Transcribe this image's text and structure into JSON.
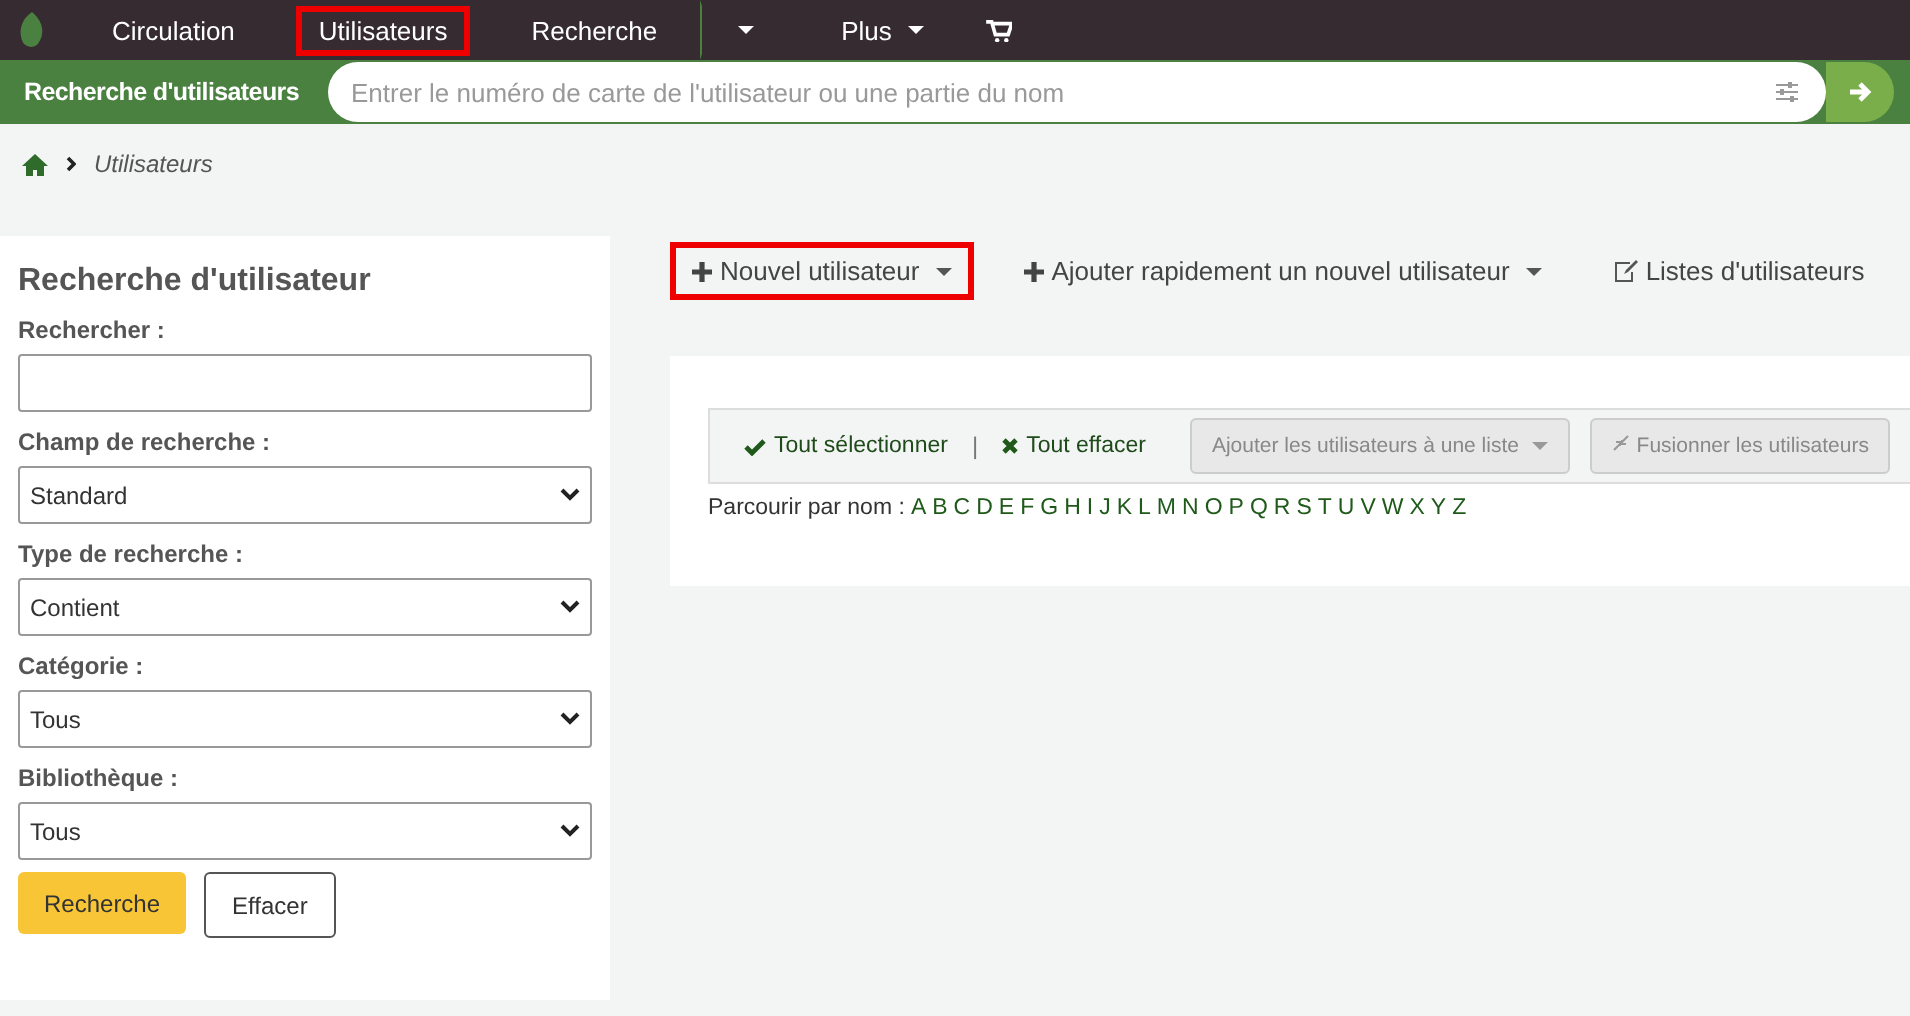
{
  "navbar": {
    "items": [
      {
        "label": "Circulation",
        "highlighted": false,
        "kind": "link"
      },
      {
        "label": "Utilisateurs",
        "highlighted": true,
        "kind": "link"
      },
      {
        "label": "Recherche",
        "highlighted": false,
        "kind": "link"
      },
      {
        "kind": "caret"
      },
      {
        "label": "Plus",
        "highlighted": false,
        "kind": "dropdown"
      },
      {
        "kind": "cart"
      }
    ]
  },
  "searchbar": {
    "tab": "Recherche d'utilisateurs",
    "placeholder": "Entrer le numéro de carte de l'utilisateur ou une partie du nom"
  },
  "breadcrumb": {
    "current": "Utilisateurs"
  },
  "sidebar": {
    "title": "Recherche d'utilisateur",
    "fields": [
      {
        "label": "Rechercher :",
        "kind": "text"
      },
      {
        "label": "Champ de recherche :",
        "kind": "select",
        "value": "Standard"
      },
      {
        "label": "Type de recherche :",
        "kind": "select",
        "value": "Contient"
      },
      {
        "label": "Catégorie :",
        "kind": "select",
        "value": "Tous"
      },
      {
        "label": "Bibliothèque :",
        "kind": "select",
        "value": "Tous"
      }
    ],
    "buttons": [
      "Recherche",
      "Effacer"
    ]
  },
  "toolbar": [
    {
      "label": "Nouvel utilisateur",
      "kind": "plus",
      "highlighted": true
    },
    {
      "label": "Ajouter rapidement un nouvel utilisateur",
      "kind": "plus",
      "highlighted": false
    },
    {
      "label": "Listes d'utilisateurs",
      "kind": "edit",
      "highlighted": false
    }
  ],
  "actions": {
    "select_all": "Tout sélectionner",
    "separator": "|",
    "clear_all": "Tout effacer",
    "add_to_list": "Ajouter les utilisateurs à une liste",
    "merge": "Fusionner les utilisateurs"
  },
  "browse": {
    "label": "Parcourir par nom :",
    "letters": [
      "A",
      "B",
      "C",
      "D",
      "E",
      "F",
      "G",
      "H",
      "I",
      "J",
      "K",
      "L",
      "M",
      "N",
      "O",
      "P",
      "Q",
      "R",
      "S",
      "T",
      "U",
      "V",
      "W",
      "X",
      "Y",
      "Z"
    ]
  }
}
